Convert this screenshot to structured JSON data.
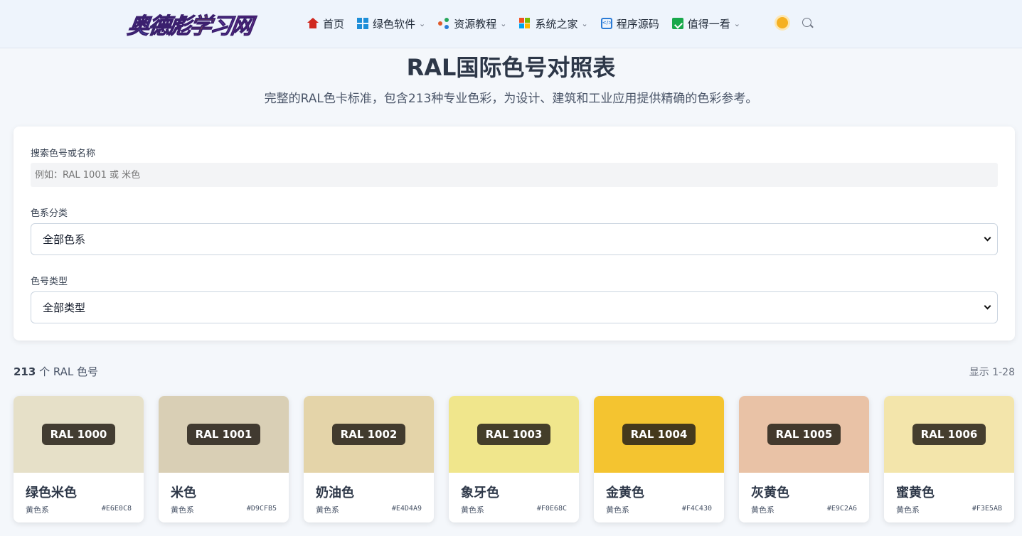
{
  "header": {
    "logo_text": "奥德彪学习网",
    "nav": [
      {
        "label": "首页",
        "icon": "home-icon",
        "dropdown": false
      },
      {
        "label": "绿色软件",
        "icon": "grid-icon",
        "dropdown": true
      },
      {
        "label": "资源教程",
        "icon": "share-icon",
        "dropdown": true
      },
      {
        "label": "系统之家",
        "icon": "windows-icon",
        "dropdown": true
      },
      {
        "label": "程序源码",
        "icon": "code-icon",
        "dropdown": false
      },
      {
        "label": "值得一看",
        "icon": "document-icon",
        "dropdown": true
      }
    ],
    "theme_toggle_icon": "sun-icon",
    "search_icon": "search-icon"
  },
  "page": {
    "title": "RAL国际色号对照表",
    "subtitle": "完整的RAL色卡标准，包含213种专业色彩，为设计、建筑和工业应用提供精确的色彩参考。"
  },
  "filters": {
    "search_label": "搜索色号或名称",
    "search_placeholder": "例如：RAL 1001 或 米色",
    "family_label": "色系分类",
    "family_value": "全部色系",
    "type_label": "色号类型",
    "type_value": "全部类型"
  },
  "results": {
    "count_number": "213",
    "count_suffix": " 个 RAL 色号",
    "range_text": "显示 1-28"
  },
  "colors": [
    {
      "code": "RAL 1000",
      "name": "绿色米色",
      "family": "黄色系",
      "hex": "#E6E0C8",
      "swatch": "#E6E0C8"
    },
    {
      "code": "RAL 1001",
      "name": "米色",
      "family": "黄色系",
      "hex": "#D9CFB5",
      "swatch": "#D9CFB5"
    },
    {
      "code": "RAL 1002",
      "name": "奶油色",
      "family": "黄色系",
      "hex": "#E4D4A9",
      "swatch": "#E4D4A9"
    },
    {
      "code": "RAL 1003",
      "name": "象牙色",
      "family": "黄色系",
      "hex": "#F0E68C",
      "swatch": "#F0E68C"
    },
    {
      "code": "RAL 1004",
      "name": "金黄色",
      "family": "黄色系",
      "hex": "#F4C430",
      "swatch": "#F4C430"
    },
    {
      "code": "RAL 1005",
      "name": "灰黄色",
      "family": "黄色系",
      "hex": "#E9C2A6",
      "swatch": "#E9C2A6"
    },
    {
      "code": "RAL 1006",
      "name": "蜜黄色",
      "family": "黄色系",
      "hex": "#F3E5AB",
      "swatch": "#F3E5AB"
    }
  ]
}
